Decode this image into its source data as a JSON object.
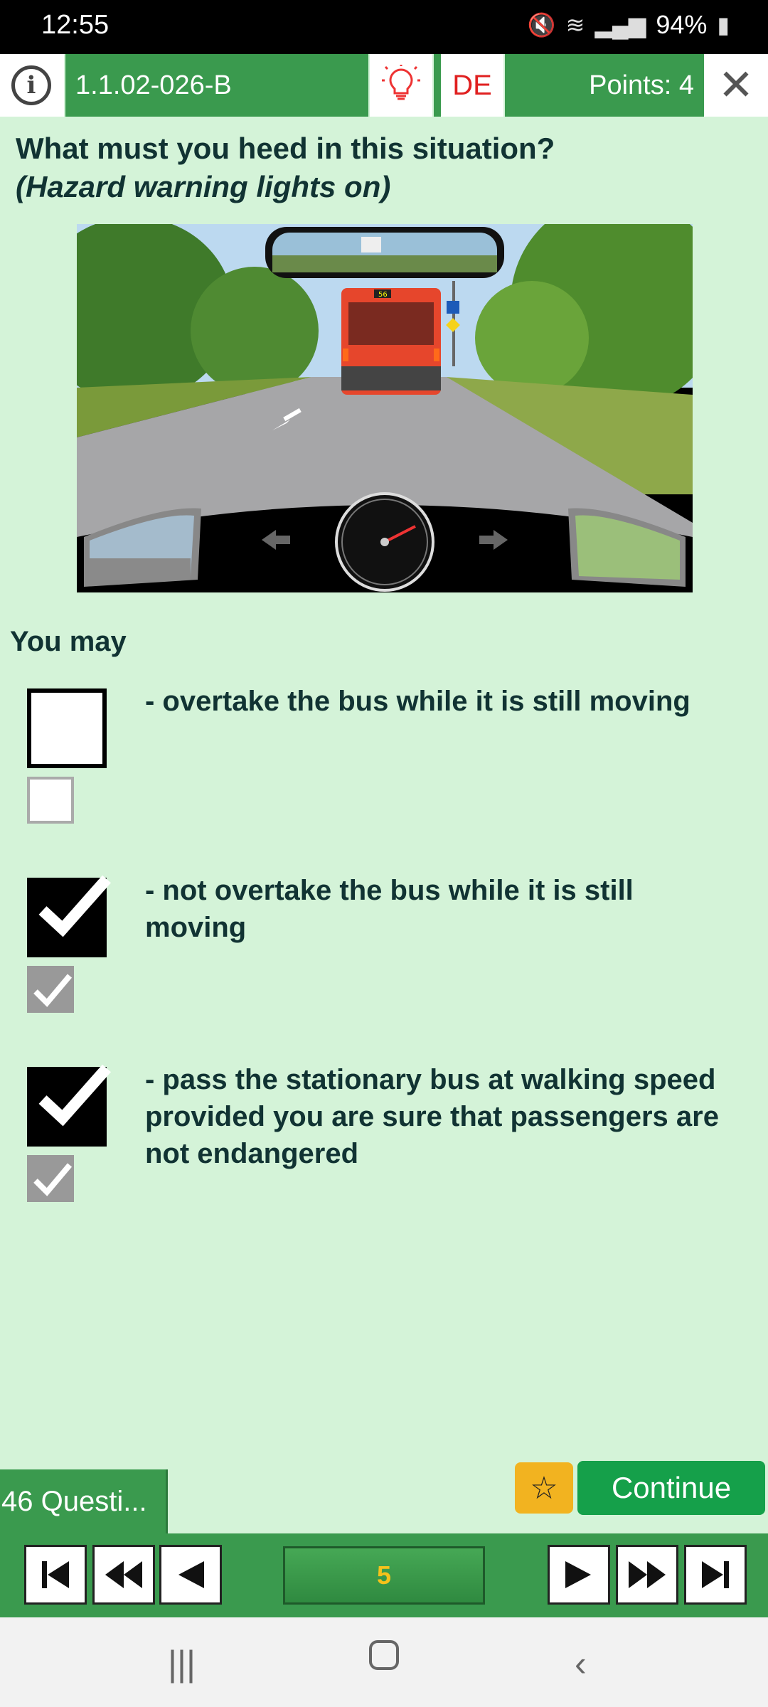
{
  "status": {
    "time": "12:55",
    "battery": "94%"
  },
  "header": {
    "info_icon": "info-icon",
    "question_id": "1.1.02-026-B",
    "tip_icon": "lightbulb-icon",
    "language": "DE",
    "points": "Points: 4",
    "close_icon": "close-icon"
  },
  "question": {
    "text": "What must you heed in this situation?",
    "subtext": "(Hazard warning lights on)"
  },
  "intro": "You may",
  "answers": [
    {
      "text": "- overtake the bus while it is still moving",
      "checked": false
    },
    {
      "text": "- not overtake the bus while it is still moving",
      "checked": true
    },
    {
      "text": "- pass the stationary bus at walking speed provided you are sure that passengers are not endangered",
      "checked": true
    }
  ],
  "scene": {
    "bus_number": "56"
  },
  "footer": {
    "question_count": "46 Questi...",
    "continue_label": "Continue",
    "current_page": "5"
  },
  "colors": {
    "green": "#3a9a4e",
    "background": "#d4f3d8",
    "continue": "#15a04a",
    "star": "#f2b320",
    "red": "#e02020"
  }
}
